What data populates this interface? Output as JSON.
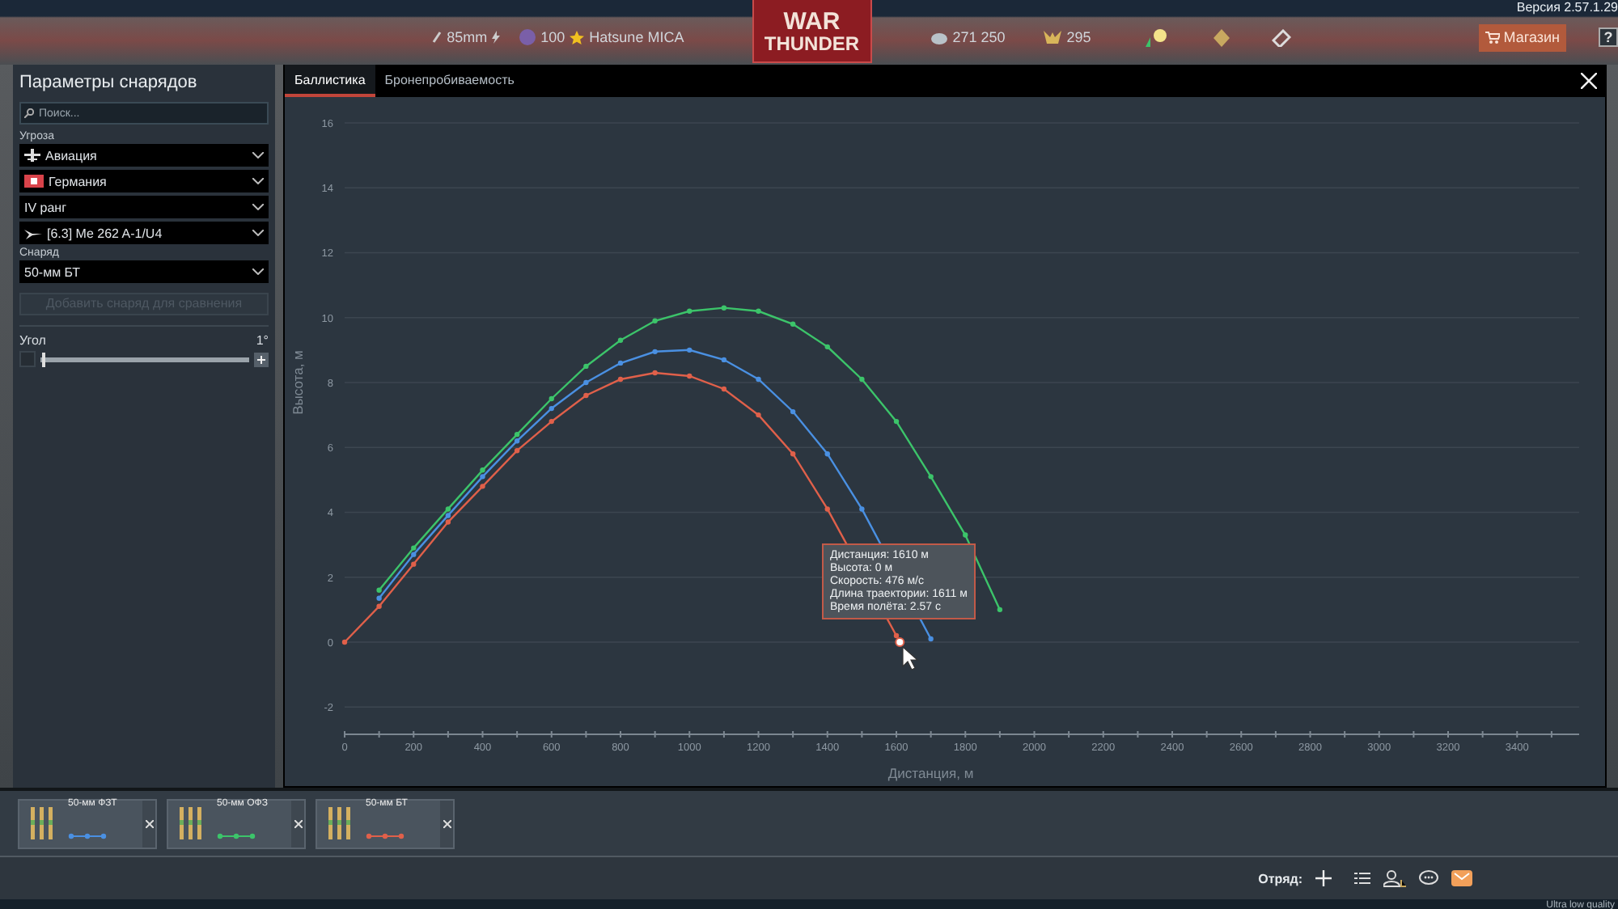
{
  "top_bar": {
    "version": "Версия 2.57.1.29",
    "caliber": "85mm",
    "rank_level": "100",
    "nickname": "Hatsune MICA",
    "logo_top": "WAR",
    "logo_bottom": "THUNDER",
    "silver": "271 250",
    "gold": "295",
    "shop_button": "Магазин",
    "help_button": "?"
  },
  "params_panel": {
    "title": "Параметры снарядов",
    "search": {
      "placeholder": "Поиск..."
    },
    "threat_label": "Угроза",
    "threat_dropdowns": [
      {
        "kind": "plane",
        "value": "Авиация"
      },
      {
        "kind": "flag",
        "value": "Германия"
      },
      {
        "kind": "plain",
        "value": "IV ранг"
      },
      {
        "kind": "aircraft",
        "value": "[6.3] Me 262 A-1/U4"
      }
    ],
    "shell_label": "Снаряд",
    "shell_dropdown": {
      "value": "50-мм БТ"
    },
    "add_button": {
      "label": "Добавить снаряд для сравнения",
      "disabled": true
    },
    "angle": {
      "label": "Угол",
      "reading": "1°",
      "level": 0.02
    }
  },
  "main_panel": {
    "tabs": [
      {
        "label": "Баллистика",
        "selected": true
      },
      {
        "label": "Бронепробиваемость",
        "selected": false
      }
    ],
    "chart_data": {
      "type": "line",
      "xlabel": "Дистанция, м",
      "ylabel": "Высота, м",
      "grid": true,
      "x": [
        0,
        100,
        200,
        300,
        400,
        500,
        600,
        700,
        800,
        900,
        1000,
        1100,
        1200,
        1300,
        1400,
        1500,
        1600,
        1700,
        1800,
        1900
      ],
      "series": [
        {
          "color": "#4a90e2",
          "marker": true,
          "values": [
            null,
            1.35,
            2.7,
            3.9,
            5.1,
            6.2,
            7.2,
            8.0,
            8.6,
            8.95,
            9.0,
            8.7,
            8.1,
            7.1,
            5.8,
            4.1,
            null,
            0.1,
            null,
            null
          ]
        },
        {
          "color": "#3cc46a",
          "marker": true,
          "values": [
            null,
            1.6,
            2.9,
            4.1,
            5.3,
            6.4,
            7.5,
            8.5,
            9.3,
            9.9,
            10.2,
            10.3,
            10.2,
            9.8,
            9.1,
            8.1,
            6.8,
            5.1,
            3.3,
            1.0
          ]
        },
        {
          "color": "#e0604a",
          "marker": true,
          "values": [
            0,
            1.1,
            2.4,
            3.7,
            4.8,
            5.9,
            6.8,
            7.6,
            8.1,
            8.3,
            8.2,
            7.8,
            7.0,
            5.8,
            4.1,
            null,
            0.2,
            null,
            null,
            null
          ]
        }
      ],
      "xlim": [
        0,
        3580
      ],
      "ylim": [
        -2,
        16
      ],
      "xticks": [
        0,
        200,
        400,
        600,
        800,
        1000,
        1200,
        1400,
        1600,
        1800,
        2000,
        2200,
        2400,
        2600,
        2800,
        3000,
        3200,
        3400
      ],
      "yticks": [
        -2,
        0,
        2,
        4,
        6,
        8,
        10,
        12,
        14,
        16
      ]
    },
    "tooltip": {
      "lines": [
        "Дистанция: 1610 м",
        "Высота: 0 м",
        "Скорость: 476 м/с",
        "Длина траектории: 1611 м",
        "Время полёта: 2.57 с"
      ]
    }
  },
  "compare_shells": [
    {
      "name": "50-мм ФЗТ",
      "color": "#4a90e2"
    },
    {
      "name": "50-мм ОФЗ",
      "color": "#3cc46a"
    },
    {
      "name": "50-мм БТ",
      "color": "#e0604a"
    }
  ],
  "bottom_bar": {
    "squad_label": "Отряд:"
  },
  "quality": "Ultra low quality"
}
